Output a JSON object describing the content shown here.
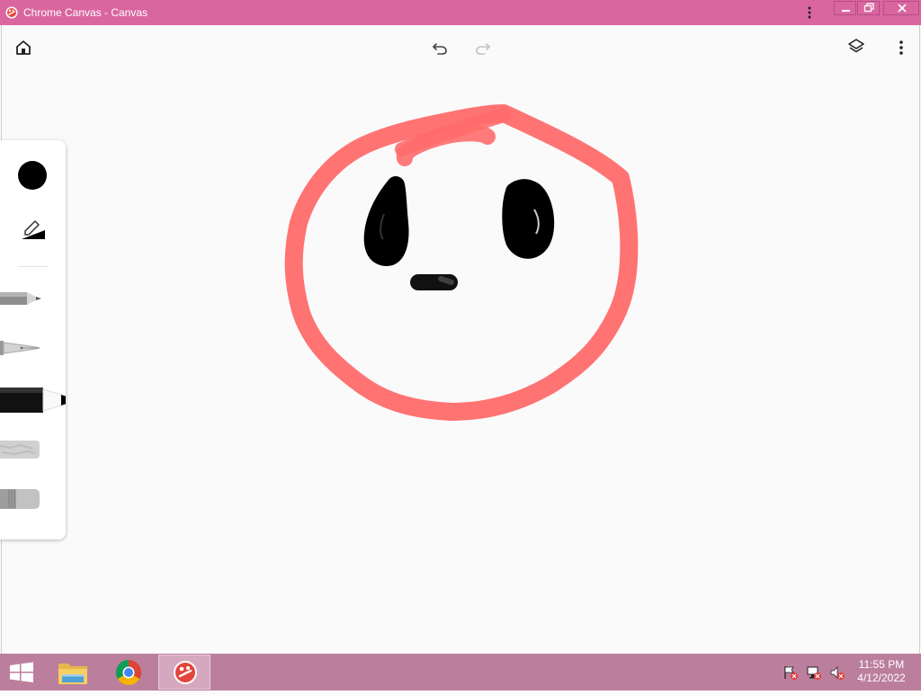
{
  "window": {
    "title": "Chrome Canvas - Canvas"
  },
  "toolbar": {
    "home_icon": "home-icon",
    "undo_icon": "undo-icon",
    "redo_icon": "redo-icon",
    "redo_enabled": false,
    "layers_icon": "layers-icon",
    "more_icon": "more-vert-icon"
  },
  "tool_panel": {
    "current_color": "#000000",
    "tools": [
      "pencil",
      "pen",
      "marker",
      "chalk",
      "eraser"
    ],
    "selected_tool": "marker"
  },
  "drawing": {
    "colors": {
      "face": "#ff6b6b",
      "features": "#000000"
    }
  },
  "taskbar": {
    "apps": [
      "File Explorer",
      "Google Chrome",
      "Chrome Canvas"
    ],
    "active_app": "Chrome Canvas",
    "time": "11:55 PM",
    "date": "4/12/2022"
  },
  "colors": {
    "titlebar": "#d9669f",
    "taskbar": "#bb7f9d",
    "canvas_bg": "#fafafa"
  }
}
